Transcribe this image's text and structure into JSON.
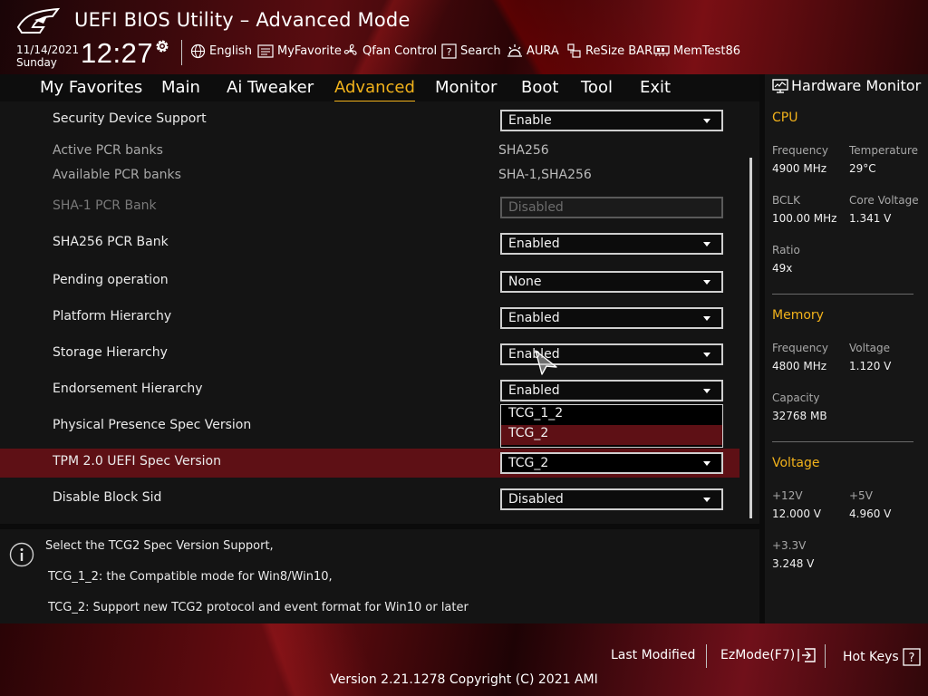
{
  "header": {
    "title": "UEFI BIOS Utility – Advanced Mode",
    "date": "11/14/2021",
    "day": "Sunday",
    "time": "12:27",
    "items": [
      {
        "label": "English",
        "icon": "globe-icon"
      },
      {
        "label": "MyFavorite",
        "icon": "favorite-icon"
      },
      {
        "label": "Qfan Control",
        "icon": "fan-icon"
      },
      {
        "label": "Search",
        "icon": "help-search-icon"
      },
      {
        "label": "AURA",
        "icon": "aura-icon"
      },
      {
        "label": "ReSize BAR",
        "icon": "resize-bar-icon"
      },
      {
        "label": "MemTest86",
        "icon": "memtest-icon"
      }
    ]
  },
  "nav": {
    "tabs": [
      "My Favorites",
      "Main",
      "Ai Tweaker",
      "Advanced",
      "Monitor",
      "Boot",
      "Tool",
      "Exit"
    ],
    "active": "Advanced"
  },
  "settings": {
    "security_device_support": {
      "label": "Security Device Support",
      "value": "Enable"
    },
    "active_pcr_banks": {
      "label": "Active PCR banks",
      "value": "SHA256"
    },
    "available_pcr_banks": {
      "label": "Available PCR banks",
      "value": "SHA-1,SHA256"
    },
    "sha1_pcr_bank": {
      "label": "SHA-1 PCR Bank",
      "value": "Disabled"
    },
    "sha256_pcr_bank": {
      "label": "SHA256 PCR Bank",
      "value": "Enabled"
    },
    "pending_operation": {
      "label": "Pending operation",
      "value": "None"
    },
    "platform_hierarchy": {
      "label": "Platform Hierarchy",
      "value": "Enabled"
    },
    "storage_hierarchy": {
      "label": "Storage Hierarchy",
      "value": "Enabled"
    },
    "endorsement_hierarchy": {
      "label": "Endorsement Hierarchy",
      "value": "Enabled"
    },
    "physical_presence": {
      "label": "Physical Presence Spec Version"
    },
    "tpm_uefi_spec": {
      "label": "TPM 2.0 UEFI Spec Version",
      "value": "TCG_2"
    },
    "disable_block_sid": {
      "label": "Disable Block Sid",
      "value": "Disabled"
    }
  },
  "dropdown_options": [
    "TCG_1_2",
    "TCG_2"
  ],
  "dropdown_highlighted": "TCG_2",
  "help": {
    "line1": "Select the TCG2 Spec Version Support,",
    "line2": "TCG_1_2: the Compatible mode for Win8/Win10,",
    "line3": "TCG_2: Support new TCG2 protocol and event format for Win10 or later"
  },
  "hardware_monitor": {
    "title": "Hardware Monitor",
    "cpu": {
      "section": "CPU",
      "frequency_label": "Frequency",
      "frequency": "4900 MHz",
      "temperature_label": "Temperature",
      "temperature": "29°C",
      "bclk_label": "BCLK",
      "bclk": "100.00 MHz",
      "core_voltage_label": "Core Voltage",
      "core_voltage": "1.341 V",
      "ratio_label": "Ratio",
      "ratio": "49x"
    },
    "memory": {
      "section": "Memory",
      "frequency_label": "Frequency",
      "frequency": "4800 MHz",
      "voltage_label": "Voltage",
      "voltage": "1.120 V",
      "capacity_label": "Capacity",
      "capacity": "32768 MB"
    },
    "voltage": {
      "section": "Voltage",
      "v12_label": "+12V",
      "v12": "12.000 V",
      "v5_label": "+5V",
      "v5": "4.960 V",
      "v33_label": "+3.3V",
      "v33": "3.248 V"
    }
  },
  "footer": {
    "last_modified": "Last Modified",
    "ezmode": "EzMode(F7)",
    "hotkeys": "Hot Keys",
    "version": "Version 2.21.1278 Copyright (C) 2021 AMI"
  },
  "colors": {
    "accent": "#f2b21b",
    "selection": "#5e1015",
    "background": "#141414"
  }
}
